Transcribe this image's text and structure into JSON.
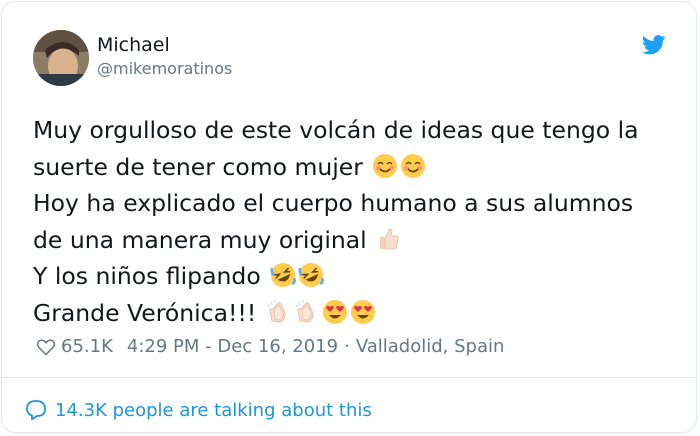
{
  "user": {
    "name": "Michael",
    "handle": "@mikemoratinos"
  },
  "tweet": {
    "lines": [
      "Muy orgulloso de este volcán de ideas que tengo la",
      "suerte de tener como mujer",
      "Hoy ha explicado el cuerpo humano a sus alumnos",
      "de una manera muy original",
      "Y los niños flipando ",
      "Grande Verónica!!!"
    ],
    "emoji": {
      "line2": [
        "smiling-face-icon",
        "smiling-face-icon"
      ],
      "line4": [
        "thumbs-up-icon"
      ],
      "line5": [
        "rolling-laughing-icon",
        "rolling-laughing-icon"
      ],
      "line6": [
        "clapping-hands-icon",
        "clapping-hands-icon",
        "heart-eyes-icon",
        "heart-eyes-icon"
      ]
    }
  },
  "meta": {
    "likes": "65.1K",
    "timestamp": "4:29 PM - Dec 16, 2019",
    "separator": "·",
    "location": "Valladolid, Spain"
  },
  "footer": {
    "talking": "14.3K people are talking about this"
  },
  "colors": {
    "twitter_blue": "#1da1f2",
    "link_blue": "#1b95e0",
    "muted": "#657786",
    "border": "#e1e8ed"
  }
}
